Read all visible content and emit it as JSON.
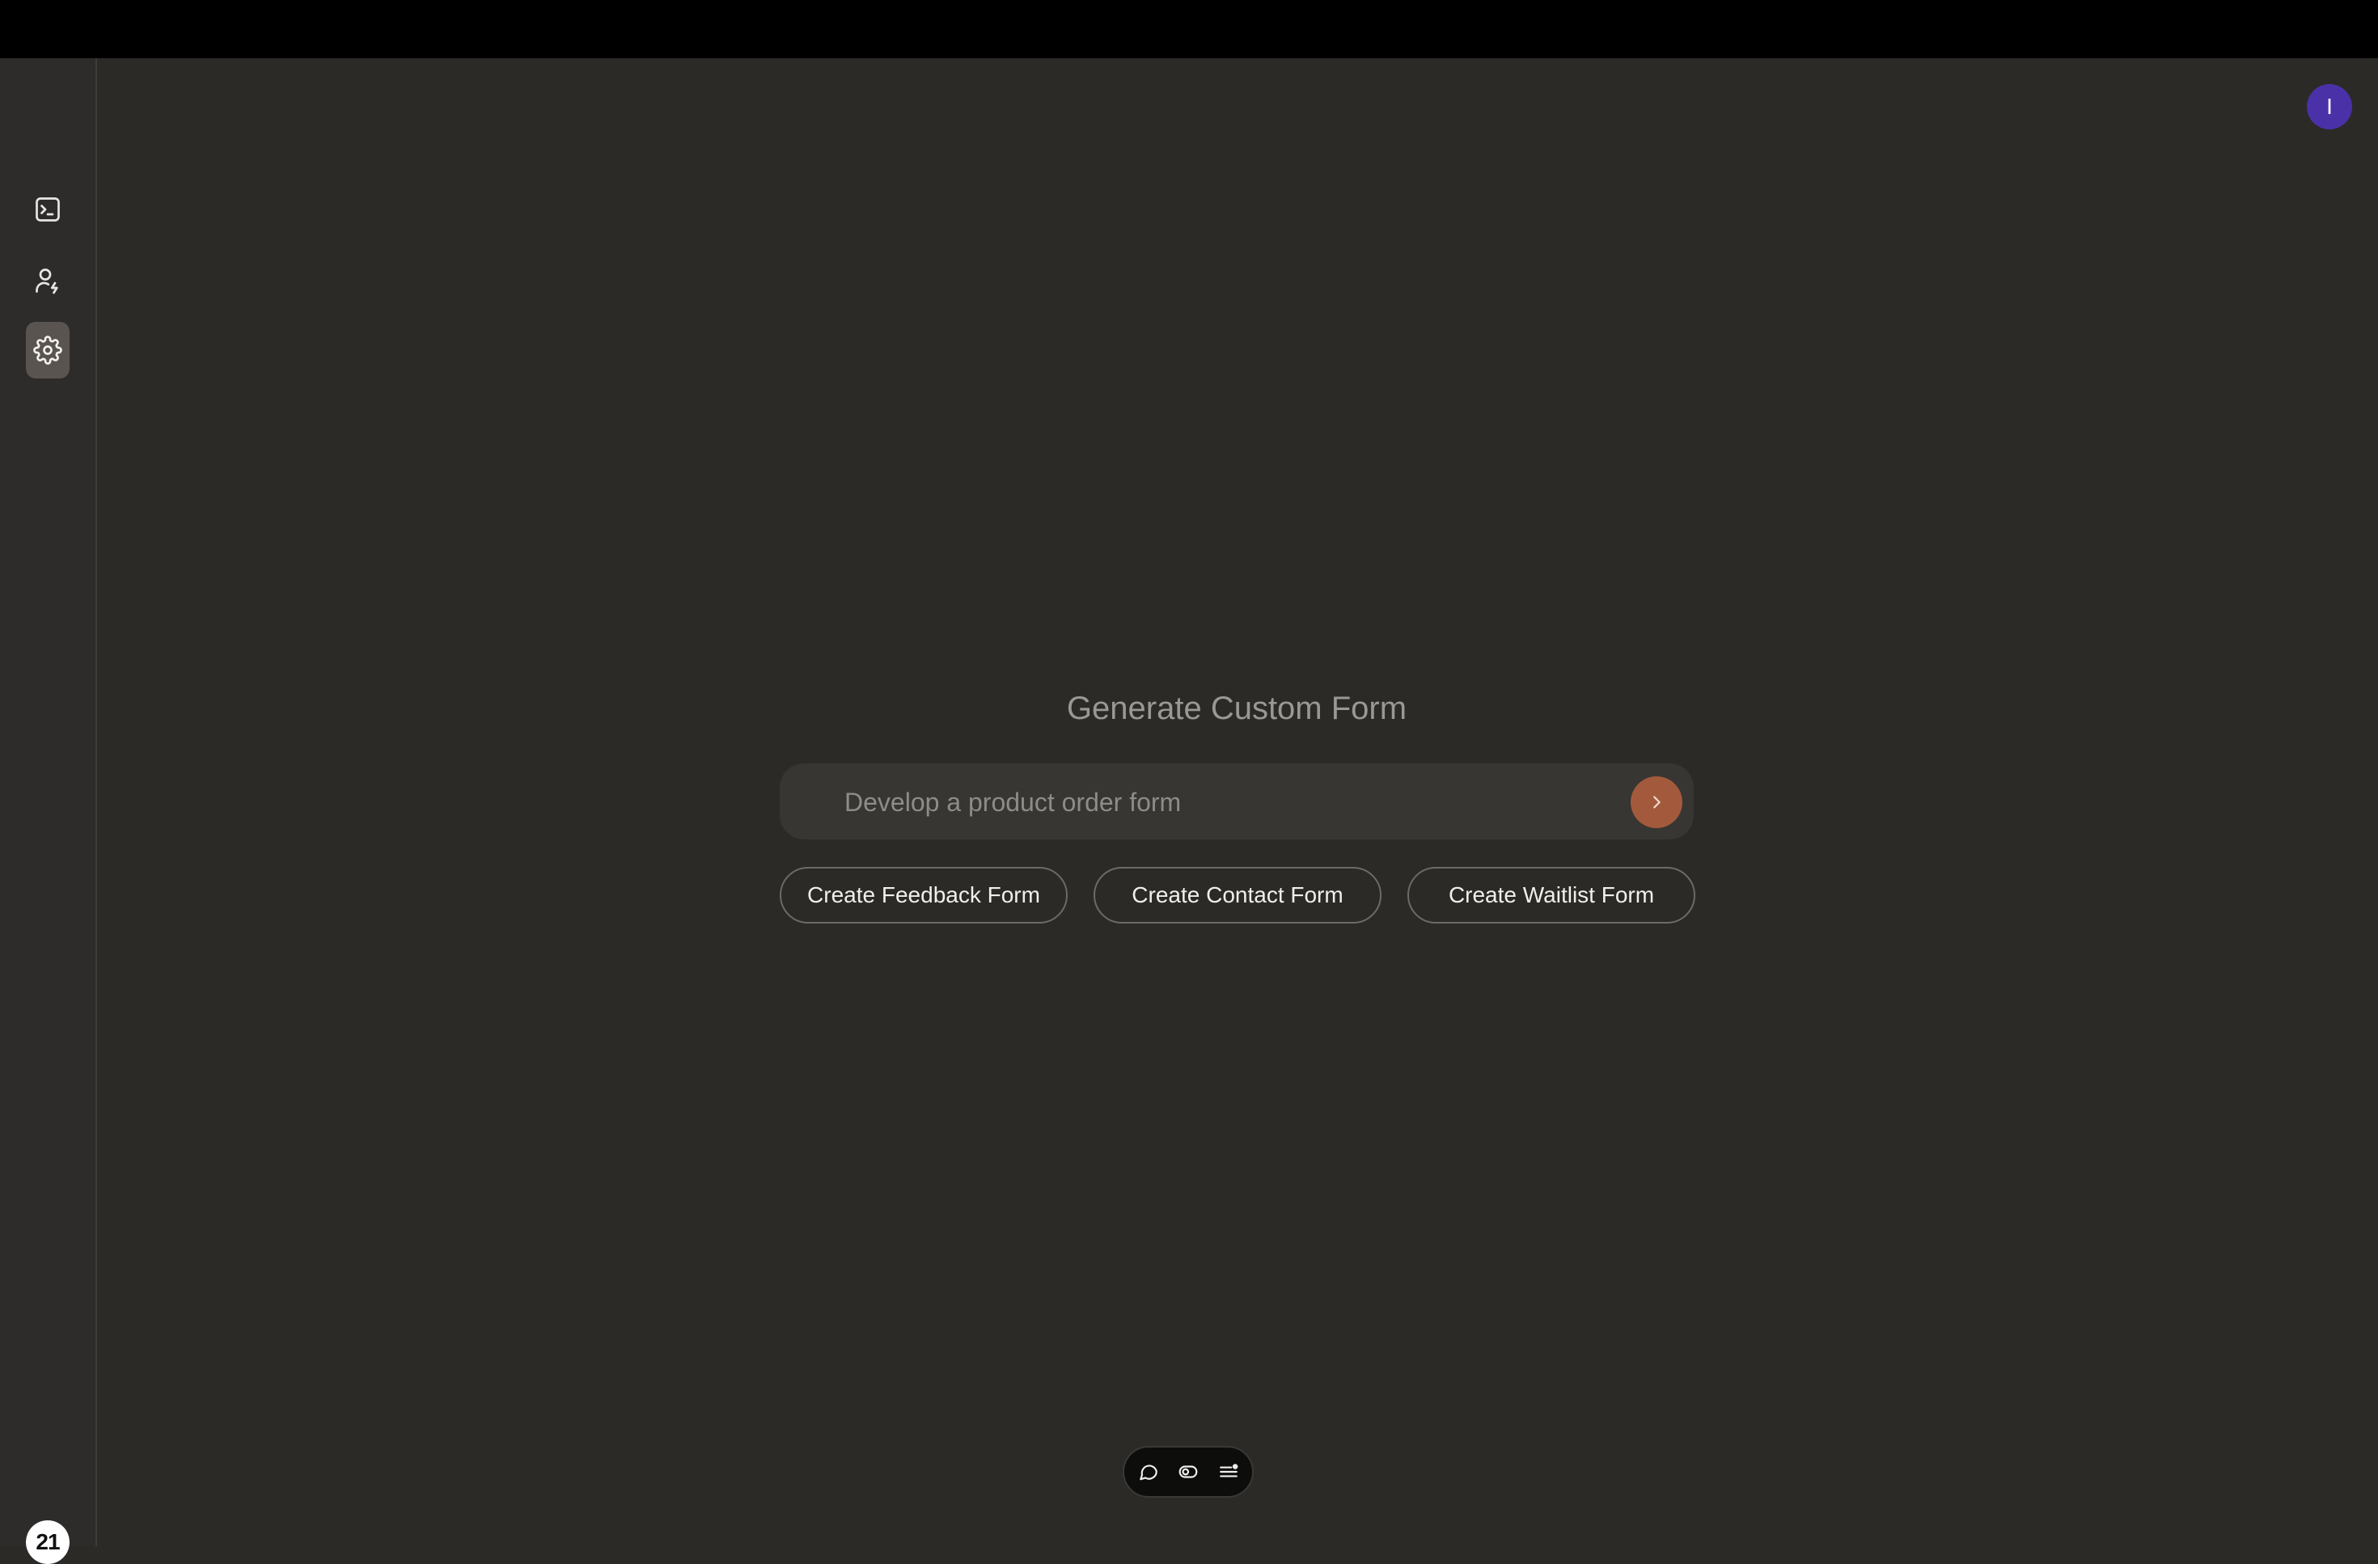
{
  "header": {
    "avatar_initial": "I"
  },
  "sidebar": {
    "items": [
      {
        "icon": "terminal-icon",
        "active": false
      },
      {
        "icon": "user-bolt-icon",
        "active": false
      },
      {
        "icon": "gear-icon",
        "active": true
      }
    ],
    "logo_text": "21"
  },
  "main": {
    "title": "Generate Custom Form",
    "prompt": {
      "placeholder": "Develop a product order form",
      "value": ""
    },
    "suggestions": [
      "Create Feedback Form",
      "Create Contact Form",
      "Create Waitlist Form"
    ]
  },
  "toolbar": {
    "items": [
      "chat-bubble-icon",
      "toggle-icon",
      "list-icon"
    ]
  },
  "colors": {
    "background": "#2b2a27",
    "accent": "#a35a3c",
    "avatar": "#4b31a8"
  }
}
